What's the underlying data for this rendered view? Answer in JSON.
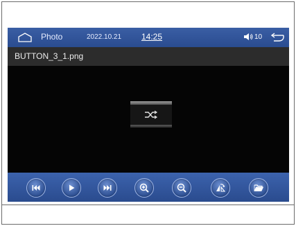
{
  "status_bar": {
    "app_title": "Photo",
    "date": "2022.10.21",
    "time": "14:25",
    "volume": "10"
  },
  "file_bar": {
    "filename": "BUTTON_3_1.png"
  },
  "preview": {
    "content_icon": "shuffle-icon"
  },
  "controls": [
    {
      "name": "previous-button",
      "icon": "skip-back-icon"
    },
    {
      "name": "play-button",
      "icon": "play-icon"
    },
    {
      "name": "next-button",
      "icon": "skip-forward-icon"
    },
    {
      "name": "zoom-in-button",
      "icon": "zoom-in-icon"
    },
    {
      "name": "zoom-out-button",
      "icon": "zoom-out-icon"
    },
    {
      "name": "rotate-button",
      "icon": "rotate-icon"
    },
    {
      "name": "open-folder-button",
      "icon": "folder-icon"
    }
  ],
  "colors": {
    "bar_blue": "#2f56a0",
    "screen_black": "#050505",
    "file_bar_gray": "#2c2c2c"
  }
}
